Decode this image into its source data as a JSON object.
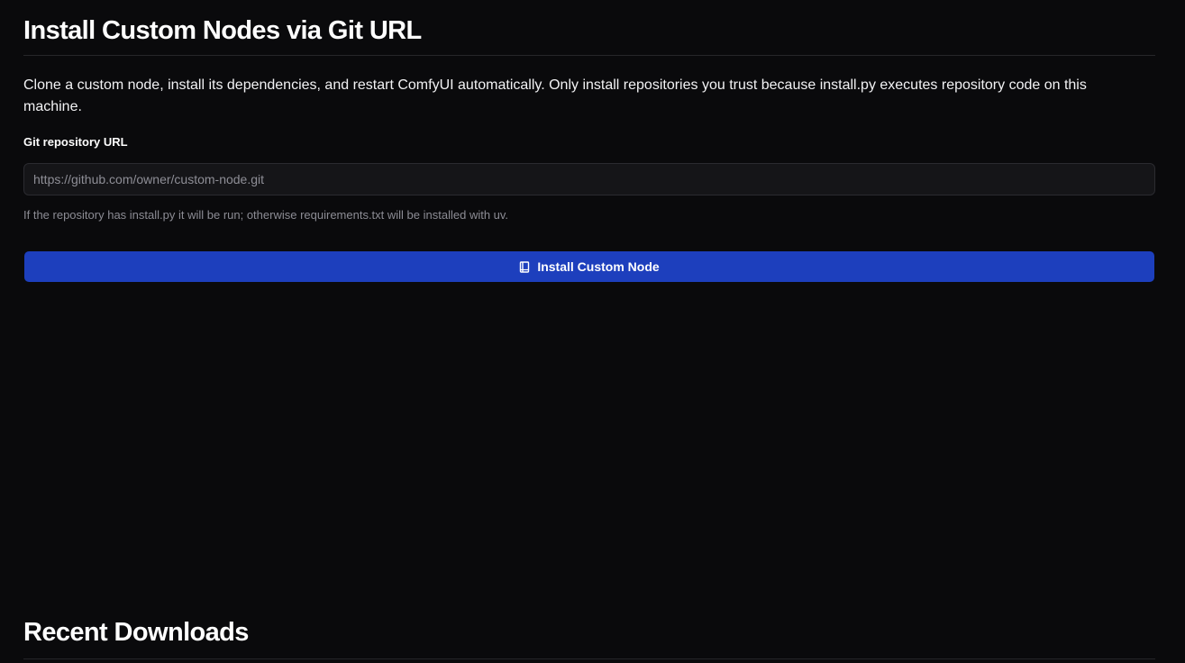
{
  "install": {
    "title": "Install Custom Nodes via Git URL",
    "description": "Clone a custom node, install its dependencies, and restart ComfyUI automatically. Only install repositories you trust because install.py executes repository code on this machine.",
    "field_label": "Git repository URL",
    "input_value": "",
    "input_placeholder": "https://github.com/owner/custom-node.git",
    "helper_text": "If the repository has install.py it will be run; otherwise requirements.txt will be installed with uv.",
    "button_label": "Install Custom Node",
    "button_icon": "book-icon",
    "accent_color": "#1d3fbd"
  },
  "downloads": {
    "title": "Recent Downloads"
  }
}
